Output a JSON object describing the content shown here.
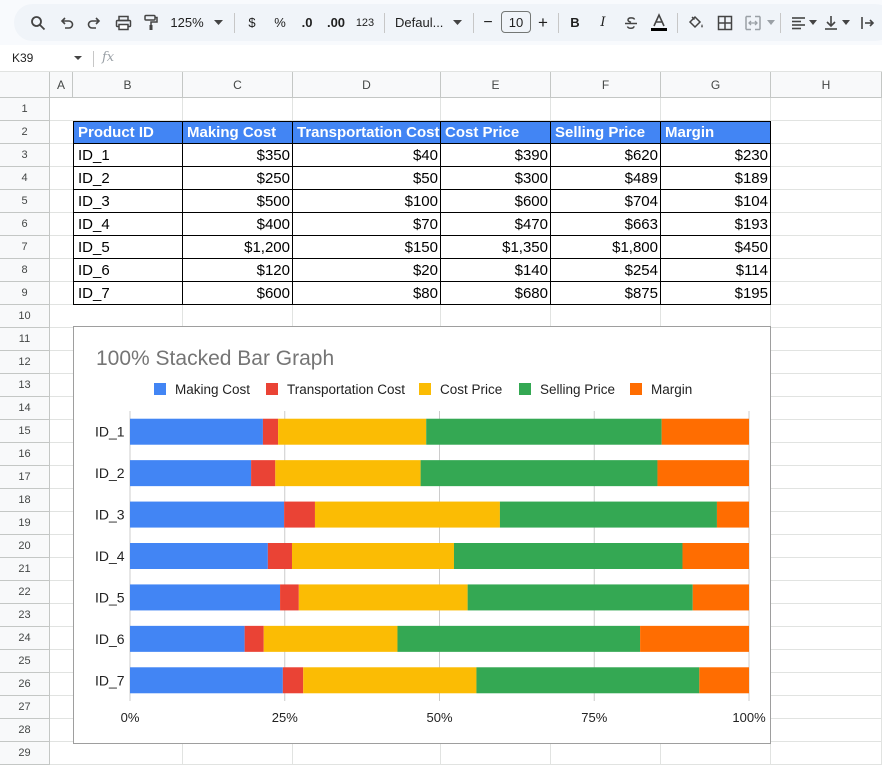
{
  "toolbar": {
    "zoom": "125%",
    "currency": "$",
    "percent": "%",
    "dec_decrease": ".0",
    "dec_increase": ".00",
    "format_123": "123",
    "font": "Defaul...",
    "font_size": "10",
    "minus": "−",
    "plus": "+",
    "bold": "B",
    "italic": "I"
  },
  "formula_bar": {
    "cell_ref": "K39",
    "fx": "fx"
  },
  "columns": [
    "A",
    "B",
    "C",
    "D",
    "E",
    "F",
    "G",
    "H"
  ],
  "rows": [
    "1",
    "2",
    "3",
    "4",
    "5",
    "6",
    "7",
    "8",
    "9",
    "10",
    "11",
    "12",
    "13",
    "14",
    "15",
    "16",
    "17",
    "18",
    "19",
    "20",
    "21",
    "22",
    "23",
    "24",
    "25",
    "26",
    "27",
    "28",
    "29"
  ],
  "table": {
    "headers": [
      "Product ID",
      "Making Cost",
      "Transportation Cost",
      "Cost Price",
      "Selling Price",
      "Margin"
    ],
    "rows": [
      [
        "ID_1",
        "$350",
        "$40",
        "$390",
        "$620",
        "$230"
      ],
      [
        "ID_2",
        "$250",
        "$50",
        "$300",
        "$489",
        "$189"
      ],
      [
        "ID_3",
        "$500",
        "$100",
        "$600",
        "$704",
        "$104"
      ],
      [
        "ID_4",
        "$400",
        "$70",
        "$470",
        "$663",
        "$193"
      ],
      [
        "ID_5",
        "$1,200",
        "$150",
        "$1,350",
        "$1,800",
        "$450"
      ],
      [
        "ID_6",
        "$120",
        "$20",
        "$140",
        "$254",
        "$114"
      ],
      [
        "ID_7",
        "$600",
        "$80",
        "$680",
        "$875",
        "$195"
      ]
    ]
  },
  "chart_data": {
    "type": "bar",
    "stacked": "percent",
    "orientation": "horizontal",
    "title": "100% Stacked Bar Graph",
    "categories": [
      "ID_1",
      "ID_2",
      "ID_3",
      "ID_4",
      "ID_5",
      "ID_6",
      "ID_7"
    ],
    "series": [
      {
        "name": "Making Cost",
        "color": "#4285f4",
        "values": [
          350,
          250,
          500,
          400,
          1200,
          120,
          600
        ]
      },
      {
        "name": "Transportation Cost",
        "color": "#ea4335",
        "values": [
          40,
          50,
          100,
          70,
          150,
          20,
          80
        ]
      },
      {
        "name": "Cost Price",
        "color": "#fbbc04",
        "values": [
          390,
          300,
          600,
          470,
          1350,
          140,
          680
        ]
      },
      {
        "name": "Selling Price",
        "color": "#34a853",
        "values": [
          620,
          489,
          704,
          663,
          1800,
          254,
          875
        ]
      },
      {
        "name": "Margin",
        "color": "#ff6d01",
        "values": [
          230,
          189,
          104,
          193,
          450,
          114,
          195
        ]
      }
    ],
    "x_ticks": [
      "0%",
      "25%",
      "50%",
      "75%",
      "100%"
    ],
    "legend": "top",
    "grid": true
  }
}
